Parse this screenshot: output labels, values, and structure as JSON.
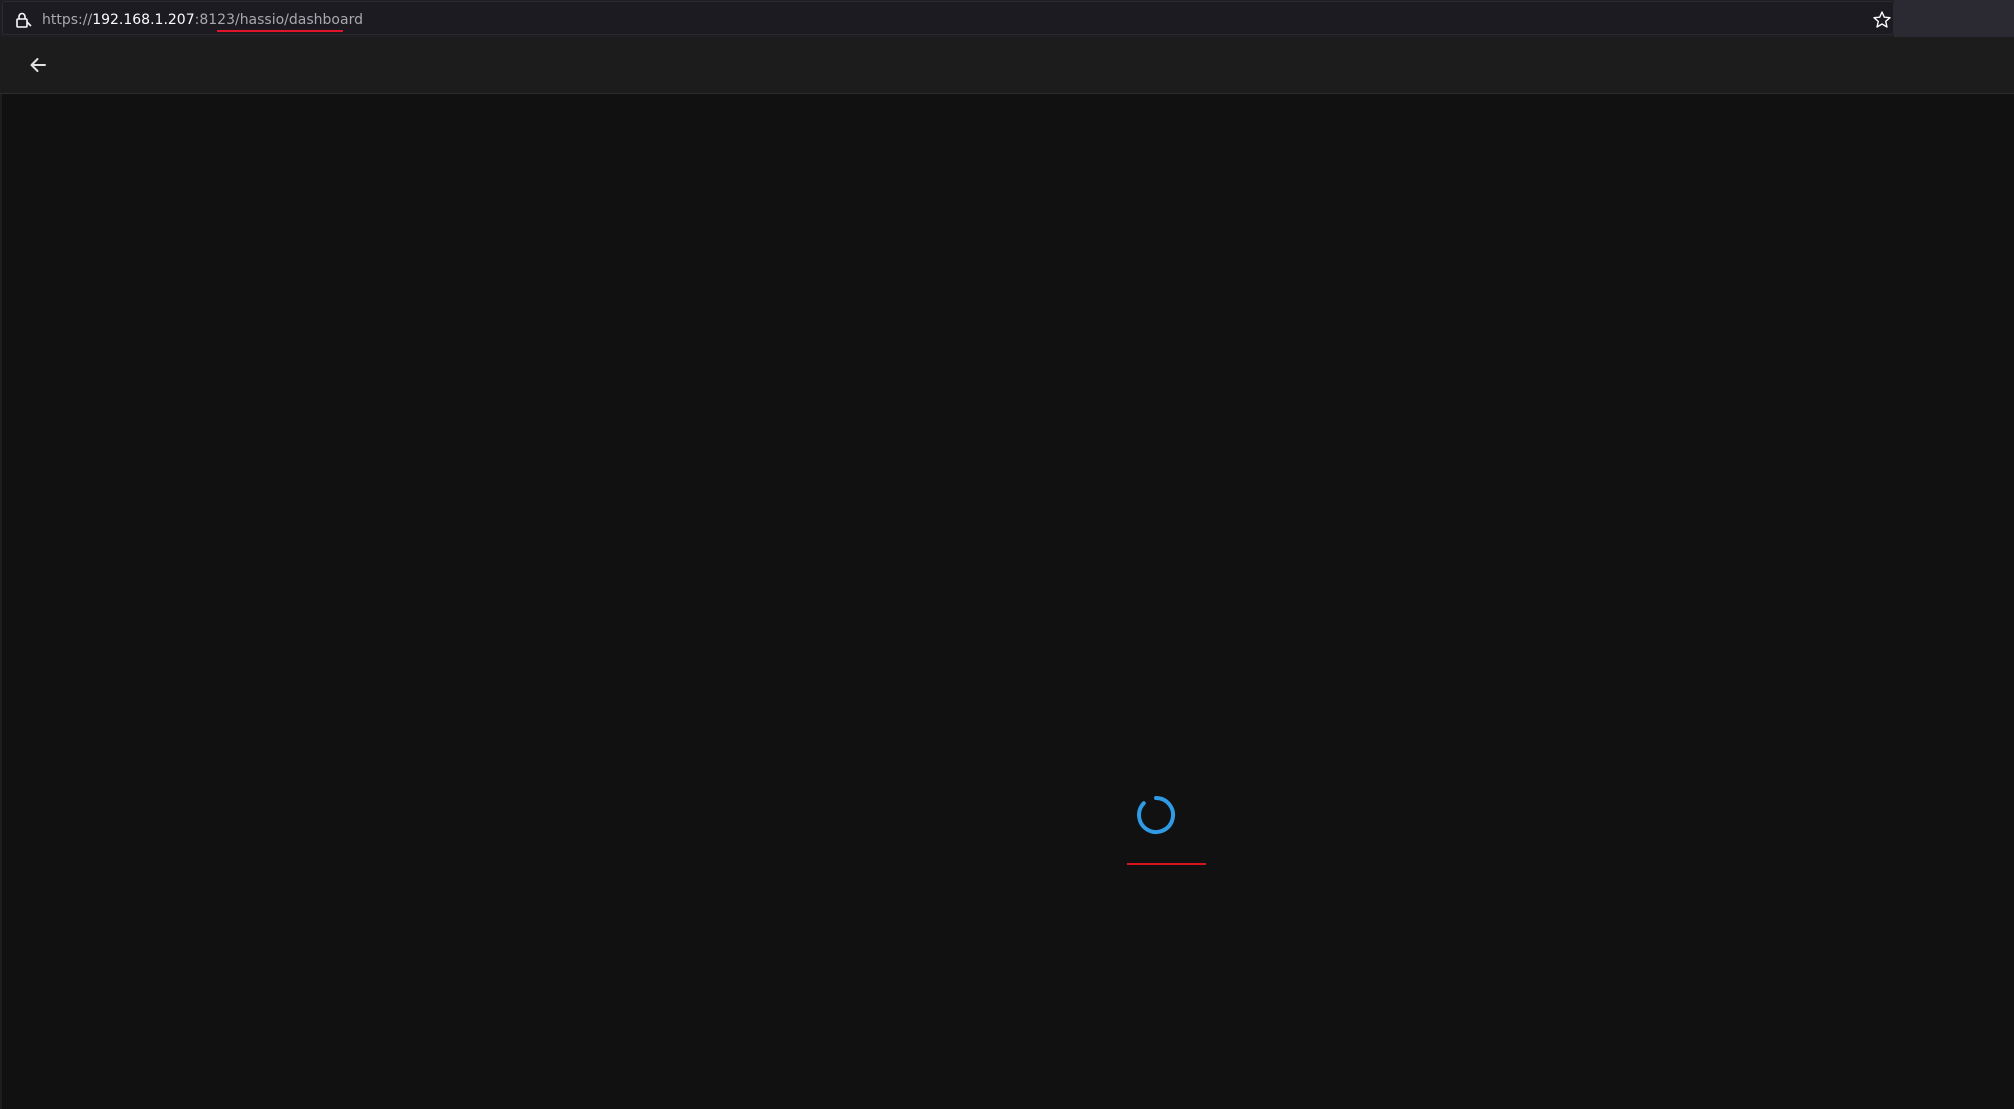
{
  "browser": {
    "url_scheme": "https://",
    "url_host": "192.168.1.207",
    "url_rest": ":8123/hassio/dashboard",
    "icons": [
      "lock-icon",
      "star-icon"
    ]
  },
  "header": {
    "back_icon": "arrow-left-icon"
  },
  "main": {
    "state": "loading",
    "spinner_color": "#2f9be4",
    "annotation_color": "#e0152c"
  }
}
